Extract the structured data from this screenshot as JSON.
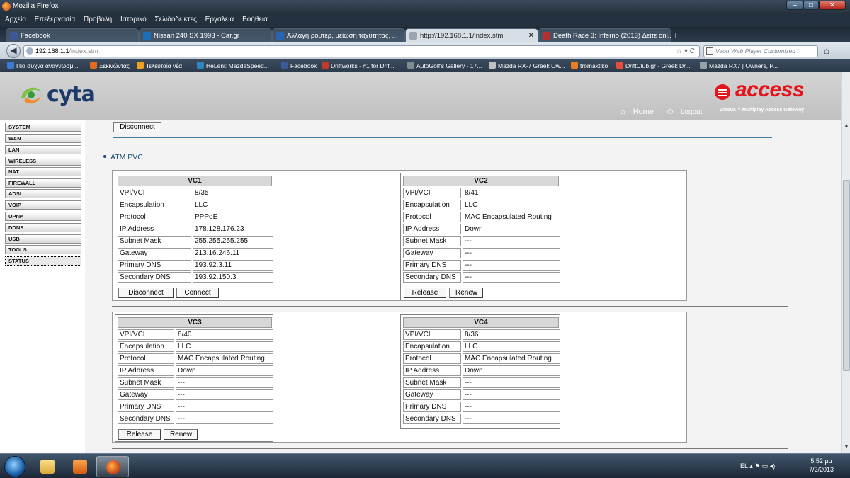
{
  "window": {
    "title": "Mozilla Firefox"
  },
  "menu": [
    "Αρχείο",
    "Επεξεργασία",
    "Προβολή",
    "Ιστορικό",
    "Σελιδοδείκτες",
    "Εργαλεία",
    "Βοήθεια"
  ],
  "tabs": [
    {
      "label": "Facebook",
      "color": "#3b5998"
    },
    {
      "label": "Nissan 240 SX 1993 - Car.gr",
      "color": "#1b6fb8"
    },
    {
      "label": "Αλλαγή ρούτερ, μείωση ταχύτητας, ...",
      "color": "#2a62b4"
    },
    {
      "label": "http://192.168.1.1/index.stm",
      "color": "#9aa5b1"
    },
    {
      "label": "Death Race 3: Inferno (2013) Δείτε onl...",
      "color": "#b53030"
    }
  ],
  "nav": {
    "url_host": "192.168.1.1",
    "url_rest": "/index.stm",
    "search_placeholder": "Veoh Web Player Customized I"
  },
  "bookmarks": [
    {
      "label": "Πιο συχνά αναγνωσμ...",
      "color": "#3a7bd5"
    },
    {
      "label": "Ξεκινώντας",
      "color": "#e36b1f"
    },
    {
      "label": "Τελευταία νέα",
      "color": "#f0a020"
    },
    {
      "label": "HeLeni: MazdaSpeed...",
      "color": "#2e86c1"
    },
    {
      "label": "Facebook",
      "color": "#3b5998"
    },
    {
      "label": "Driftworks - #1 for Drif...",
      "color": "#c0392b"
    },
    {
      "label": "AutoGolf's Gallery - 17...",
      "color": "#7f8c8d"
    },
    {
      "label": "Mazda RX-7 Greek Ow...",
      "color": "#c0c0c0"
    },
    {
      "label": "tromaktiko",
      "color": "#e67e22"
    },
    {
      "label": "DriftClub.gr - Greek Dr...",
      "color": "#e74c3c"
    },
    {
      "label": "Mazda RX7 | Owners, P...",
      "color": "#95a5a6"
    }
  ],
  "header": {
    "brand": "cyta",
    "product": "access",
    "product_sub": "Discus™ Multiplay Access Gateway",
    "home": "Home",
    "logout": "Logout"
  },
  "sidebar": [
    "SYSTEM",
    "WAN",
    "LAN",
    "WIRELESS",
    "NAT",
    "FIREWALL",
    "ADSL",
    "VOIP",
    "UPnP",
    "DDNS",
    "USB",
    "TOOLS",
    "STATUS"
  ],
  "top_disconnect": "Disconnect",
  "section_title": "ATM PVC",
  "field_labels": [
    "VPI/VCI",
    "Encapsulation",
    "Protocol",
    "IP Address",
    "Subnet Mask",
    "Gateway",
    "Primary DNS",
    "Secondary DNS"
  ],
  "pvcs": [
    {
      "title": "VC1",
      "values": [
        "8/35",
        "LLC",
        "PPPoE",
        "178.128.176.23",
        "255.255.255.255",
        "213.16.246.11",
        "193.92.3.11",
        "193.92.150.3"
      ],
      "buttons": [
        "Disconnect",
        "Connect"
      ]
    },
    {
      "title": "VC2",
      "values": [
        "8/41",
        "LLC",
        "MAC Encapsulated Routing",
        "Down",
        "---",
        "---",
        "---",
        "---"
      ],
      "buttons": [
        "Release",
        "Renew"
      ]
    },
    {
      "title": "VC3",
      "values": [
        "8/40",
        "LLC",
        "MAC Encapsulated Routing",
        "Down",
        "---",
        "---",
        "---",
        "---"
      ],
      "buttons": [
        "Release",
        "Renew"
      ]
    },
    {
      "title": "VC4",
      "values": [
        "8/36",
        "LLC",
        "MAC Encapsulated Routing",
        "Down",
        "---",
        "---",
        "---",
        "---"
      ],
      "buttons": []
    }
  ],
  "taskbar": {
    "lang": "EL",
    "time": "5:52 μμ",
    "date": "7/2/2013"
  }
}
